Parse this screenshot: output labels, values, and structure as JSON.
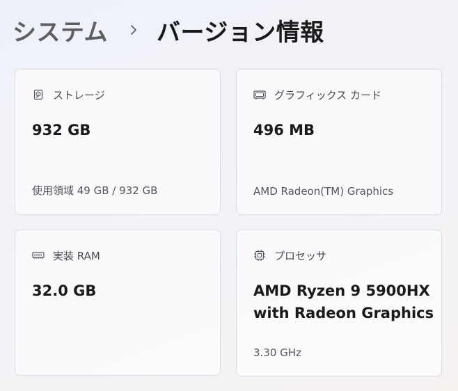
{
  "breadcrumb": {
    "parent": "システム",
    "separator_icon": "chevron-right-icon",
    "current": "バージョン情報"
  },
  "cards": {
    "storage": {
      "icon": "storage-drive-icon",
      "title": "ストレージ",
      "value": "932 GB",
      "detail": "使用領域 49 GB / 932 GB"
    },
    "graphics": {
      "icon": "graphics-card-icon",
      "title": "グラフィックス カード",
      "value": "496 MB",
      "detail": "AMD Radeon(TM) Graphics"
    },
    "ram": {
      "icon": "memory-icon",
      "title": "実装 RAM",
      "value": "32.0 GB",
      "detail": ""
    },
    "processor": {
      "icon": "processor-chip-icon",
      "title": "プロセッサ",
      "value_line1": "AMD Ryzen 9 5900HX",
      "value_line2": "with Radeon Graphics",
      "detail": "3.30 GHz"
    }
  },
  "colors": {
    "card_background": "#fbfbfd",
    "card_border": "#dcdde2",
    "text_primary": "#1a1a1a",
    "text_secondary": "#55565a",
    "breadcrumb_parent": "#5e5f63"
  }
}
